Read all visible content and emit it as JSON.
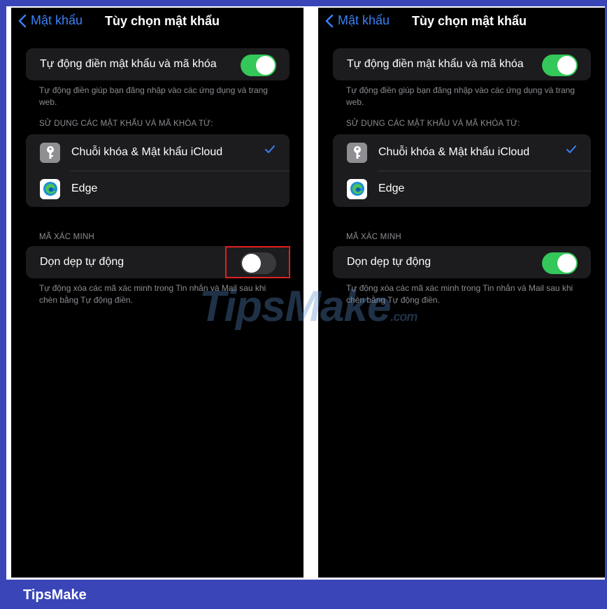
{
  "screens": [
    {
      "nav": {
        "back_label": "Mật khẩu",
        "title": "Tùy chọn mật khẩu"
      },
      "autofill": {
        "label": "Tự động điền mật khẩu và mã khóa",
        "state": "on",
        "footnote": "Tự động điền giúp bạn đăng nhập vào các ứng dụng và trang web."
      },
      "sources": {
        "header": "SỬ DỤNG CÁC MẬT KHẨU VÀ MÃ KHÓA TỪ:",
        "items": [
          {
            "label": "Chuỗi khóa & Mật khẩu iCloud",
            "icon": "keychain-icon",
            "checked": true
          },
          {
            "label": "Edge",
            "icon": "edge-icon",
            "checked": false
          }
        ]
      },
      "verification": {
        "header": "MÃ XÁC MINH",
        "label": "Dọn dẹp tự động",
        "state": "off",
        "footnote": "Tự động xóa các mã xác minh trong Tin nhắn và Mail sau khi chèn bằng Tự động điền."
      }
    },
    {
      "nav": {
        "back_label": "Mật khẩu",
        "title": "Tùy chọn mật khẩu"
      },
      "autofill": {
        "label": "Tự động điền mật khẩu và mã khóa",
        "state": "on",
        "footnote": "Tự động điền giúp bạn đăng nhập vào các ứng dụng và trang web."
      },
      "sources": {
        "header": "SỬ DỤNG CÁC MẬT KHẨU VÀ MÃ KHÓA TỪ:",
        "items": [
          {
            "label": "Chuỗi khóa & Mật khẩu iCloud",
            "icon": "keychain-icon",
            "checked": true
          },
          {
            "label": "Edge",
            "icon": "edge-icon",
            "checked": false
          }
        ]
      },
      "verification": {
        "header": "MÃ XÁC MINH",
        "label": "Dọn dẹp tự động",
        "state": "on",
        "footnote": "Tự động xóa các mã xác minh trong Tin nhắn và Mail sau khi chèn bằng Tự động điền."
      }
    }
  ],
  "watermark": {
    "main": "TipsMake",
    "suffix": ".com"
  },
  "brand": "TipsMake",
  "colors": {
    "accent": "#3a82f7",
    "toggle_on": "#34c759",
    "highlight": "#e02020",
    "frame": "#3a45b8"
  }
}
